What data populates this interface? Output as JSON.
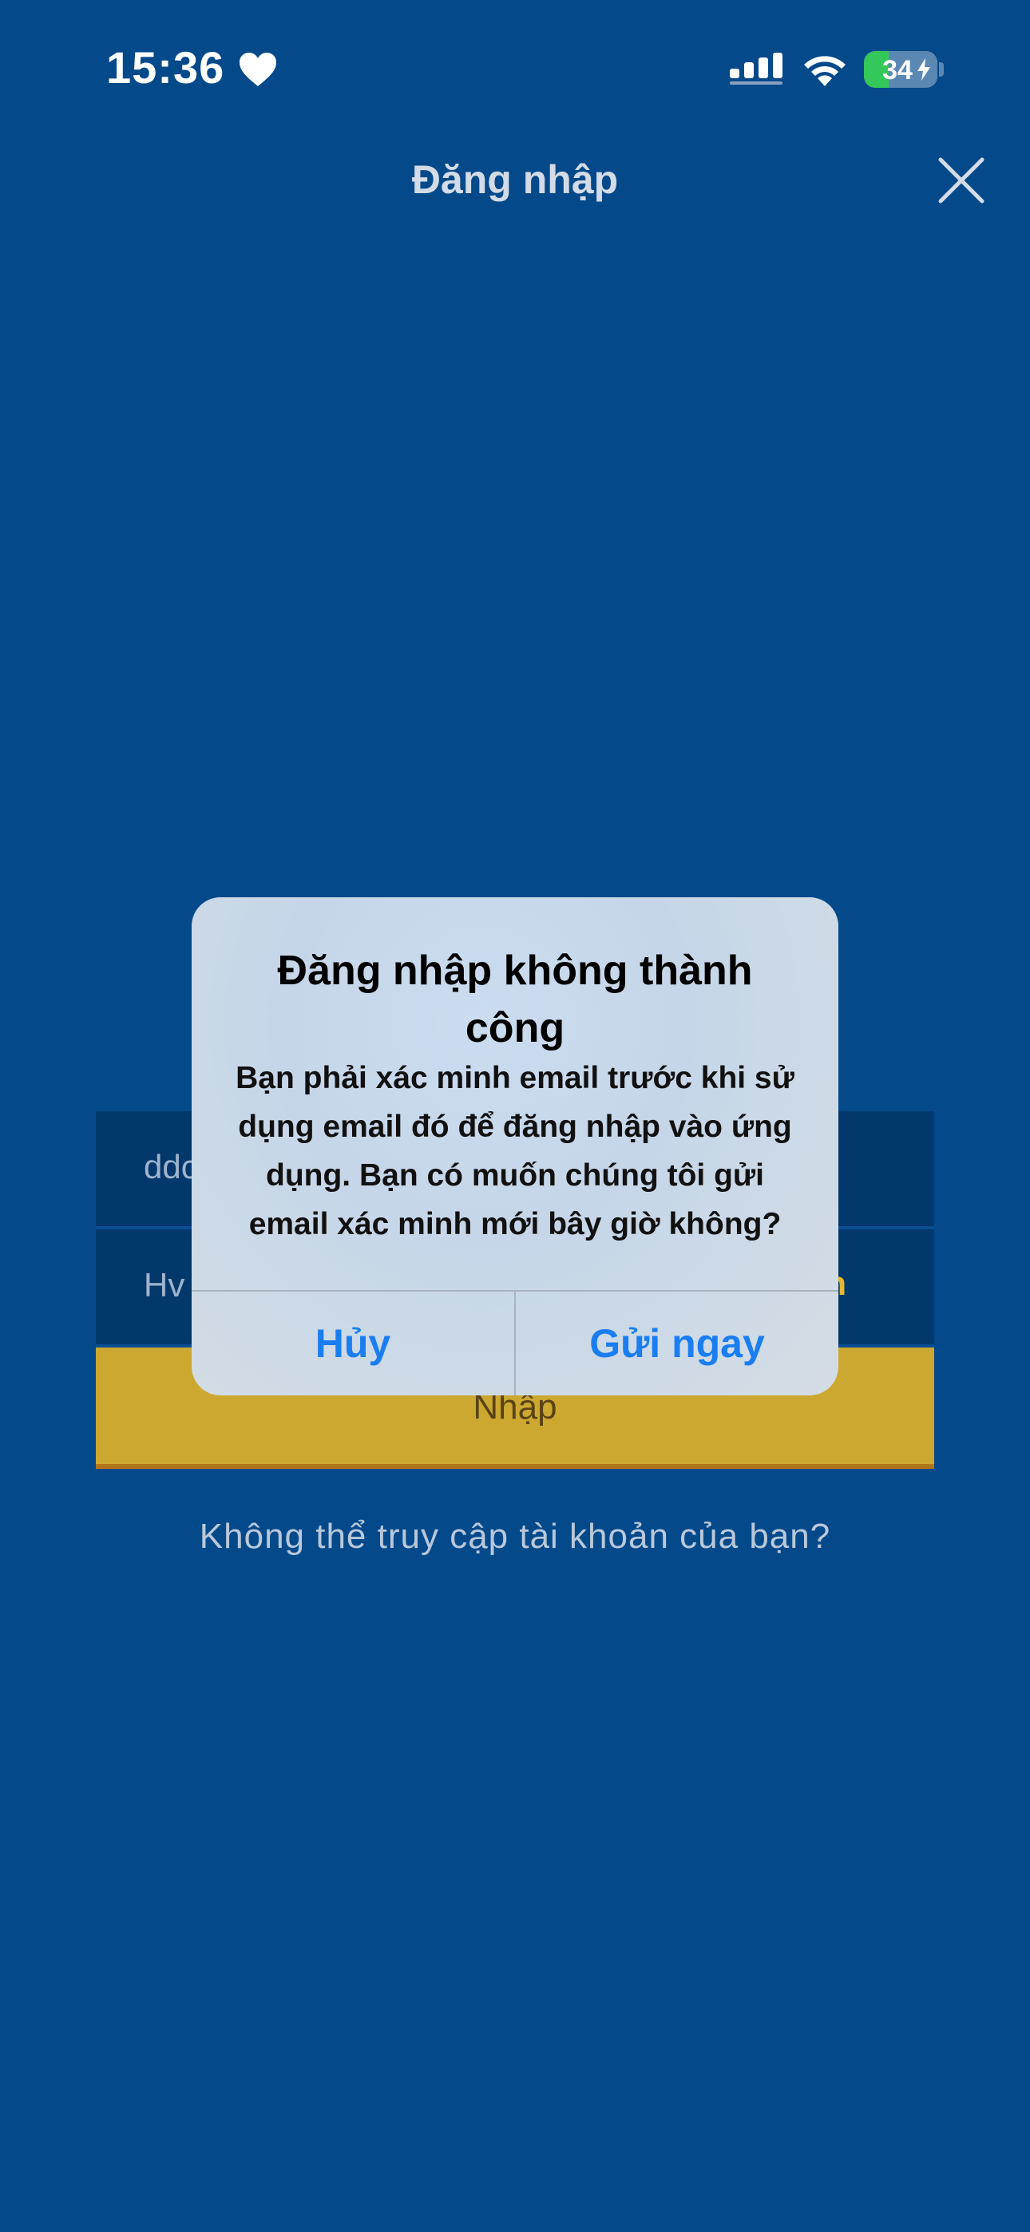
{
  "status_bar": {
    "time": "15:36",
    "battery": "34",
    "battery_level": 0.34,
    "icons": [
      "heart-icon",
      "signal-icon",
      "wifi-icon",
      "battery-icon",
      "charging-bolt-icon"
    ]
  },
  "header": {
    "title": "Đăng nhập",
    "close_icon": "close-icon"
  },
  "form": {
    "email_value": "ddc",
    "password_value": "Hv",
    "forgot_label": "n",
    "login_label": "Nhập"
  },
  "footer": {
    "cant_access_label": "Không thể truy cập tài khoản của bạn?"
  },
  "alert": {
    "title": "Đăng nhập không thành công",
    "message": "Bạn phải xác minh email trước khi sử dụng email đó để đăng nhập vào ứng dụng. Bạn có muốn chúng tôi gửi email xác minh mới bây giờ không?",
    "cancel_label": "Hủy",
    "send_label": "Gửi ngay"
  },
  "colors": {
    "background": "#04498a",
    "field": "#03386c",
    "button": "#cca830",
    "link": "#e6b82e",
    "alert_action": "#1a7ef0"
  }
}
